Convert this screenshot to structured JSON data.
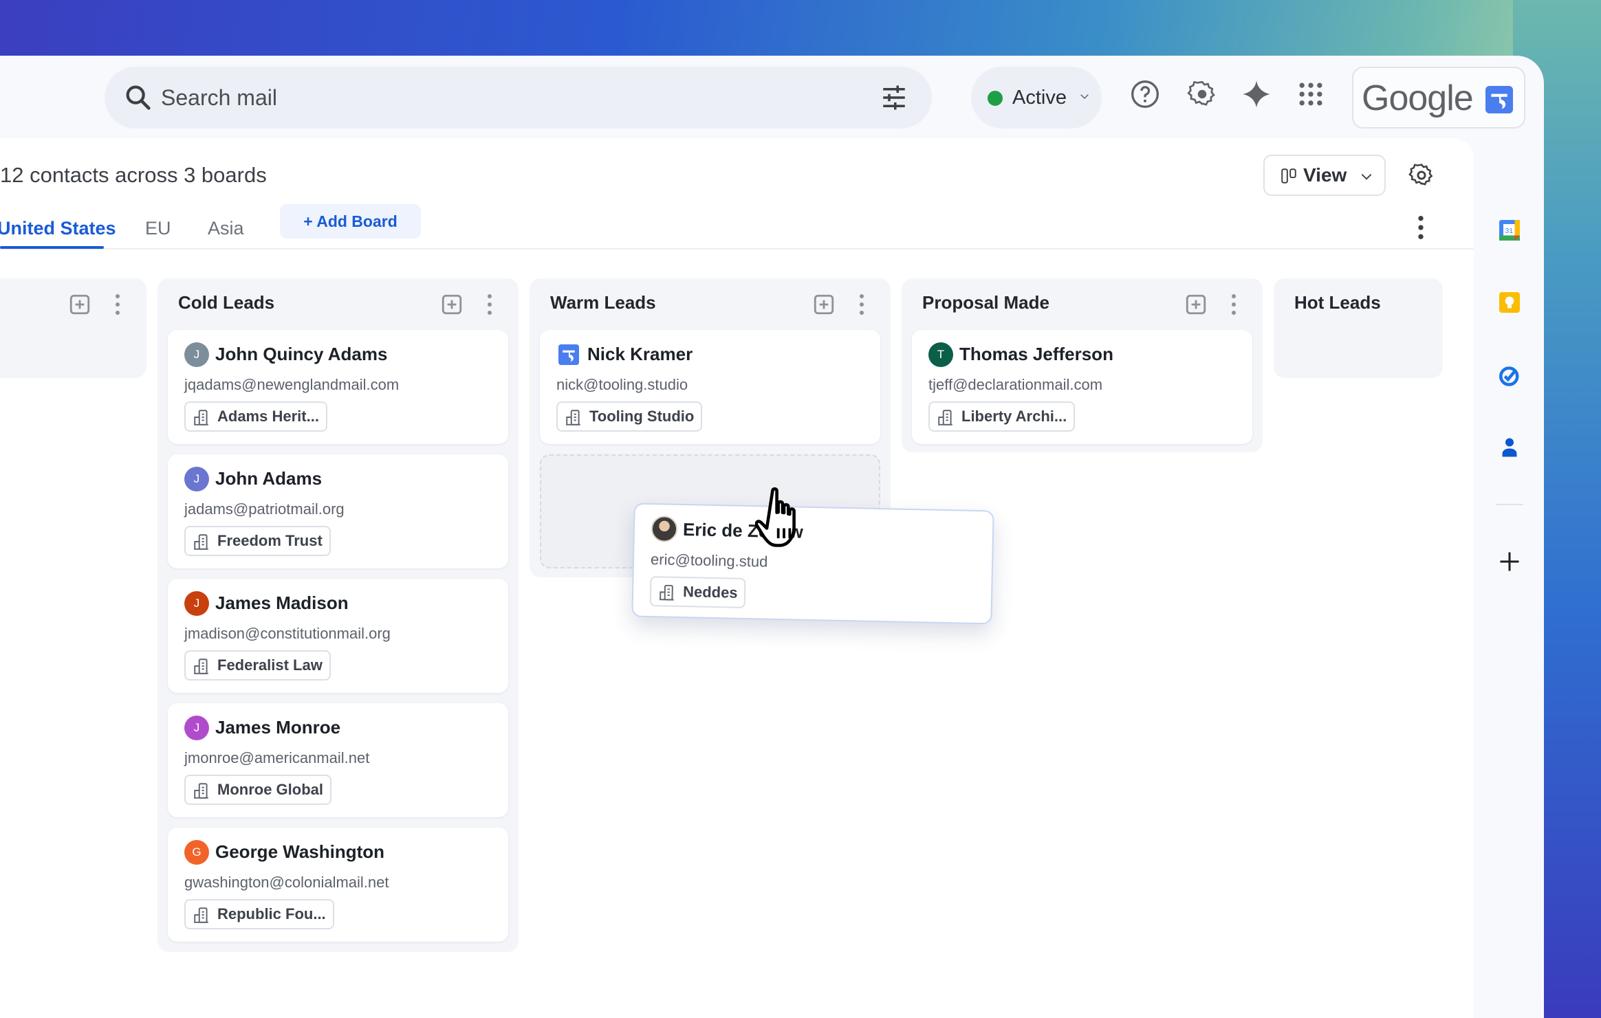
{
  "topbar": {
    "search_placeholder": "Search mail",
    "status_label": "Active",
    "status_color": "#1e9e45",
    "icons": [
      "search-icon",
      "tune-icon",
      "help-icon",
      "settings-icon",
      "gemini-sparkle-icon",
      "apps-grid-icon"
    ],
    "brand_word": "Google",
    "extension_logo": "tooling-studio-logo"
  },
  "content": {
    "summary": "12 contacts across 3 boards",
    "view_label": "View",
    "tabs": [
      {
        "label": "United States",
        "active": true
      },
      {
        "label": "EU",
        "active": false
      },
      {
        "label": "Asia",
        "active": false
      }
    ],
    "add_board_label": "+ Add Board",
    "accent_color": "#1a5bd6"
  },
  "columns": [
    {
      "title": "",
      "cards": []
    },
    {
      "title": "Cold Leads",
      "cards": [
        {
          "name": "John Quincy Adams",
          "initial": "J",
          "avatar_color": "#7d8e9b",
          "email": "jqadams@newenglandmail.com",
          "company": "Adams Herit..."
        },
        {
          "name": "John Adams",
          "initial": "J",
          "avatar_color": "#6a76cf",
          "email": "jadams@patriotmail.org",
          "company": "Freedom Trust"
        },
        {
          "name": "James Madison",
          "initial": "J",
          "avatar_color": "#c9400f",
          "email": "jmadison@constitutionmail.org",
          "company": "Federalist Law"
        },
        {
          "name": "James Monroe",
          "initial": "J",
          "avatar_color": "#b04ccc",
          "email": "jmonroe@americanmail.net",
          "company": "Monroe Global"
        },
        {
          "name": "George Washington",
          "initial": "G",
          "avatar_color": "#f2632a",
          "email": "gwashington@colonialmail.net",
          "company": "Republic Fou..."
        }
      ]
    },
    {
      "title": "Warm Leads",
      "cards": [
        {
          "name": "Nick Kramer",
          "initial": "",
          "avatar_type": "logo",
          "email": "nick@tooling.studio",
          "company": "Tooling Studio"
        }
      ]
    },
    {
      "title": "Proposal Made",
      "cards": [
        {
          "name": "Thomas Jefferson",
          "initial": "T",
          "avatar_color": "#0b5e47",
          "email": "tjeff@declarationmail.com",
          "company": "Liberty Archi..."
        }
      ]
    },
    {
      "title": "Hot Leads",
      "cards": []
    }
  ],
  "dragging_card": {
    "name": "Eric de Zeeuw",
    "avatar_type": "photo",
    "email": "eric@tooling.stud",
    "company": "Neddes"
  },
  "right_rail": {
    "icons": [
      "google-calendar-icon",
      "google-keep-icon",
      "google-tasks-icon",
      "google-contacts-icon",
      "add-addon-icon"
    ],
    "calendar_day": "31"
  }
}
